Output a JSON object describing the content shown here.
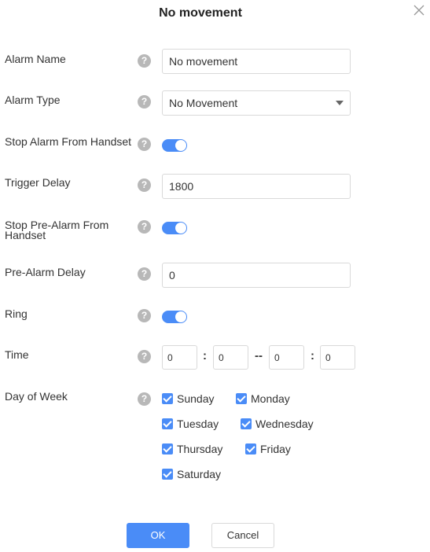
{
  "dialog": {
    "title": "No movement",
    "close_icon": "close-icon"
  },
  "fields": {
    "alarm_name": {
      "label": "Alarm Name",
      "value": "No movement"
    },
    "alarm_type": {
      "label": "Alarm Type",
      "selected": "No Movement"
    },
    "stop_alarm_from_handset": {
      "label": "Stop Alarm From Handset",
      "on": true
    },
    "trigger_delay": {
      "label": "Trigger Delay",
      "value": "1800"
    },
    "stop_pre_alarm_from_handset": {
      "label": "Stop Pre-Alarm From Handset",
      "on": true
    },
    "pre_alarm_delay": {
      "label": "Pre-Alarm Delay",
      "value": "0"
    },
    "ring": {
      "label": "Ring",
      "on": true
    },
    "time": {
      "label": "Time",
      "start_hour": "0",
      "start_minute": "0",
      "end_hour": "0",
      "end_minute": "0",
      "colon": ":",
      "range_separator": "--"
    },
    "day_of_week": {
      "label": "Day of Week",
      "days": [
        {
          "label": "Sunday",
          "checked": true
        },
        {
          "label": "Monday",
          "checked": true
        },
        {
          "label": "Tuesday",
          "checked": true
        },
        {
          "label": "Wednesday",
          "checked": true
        },
        {
          "label": "Thursday",
          "checked": true
        },
        {
          "label": "Friday",
          "checked": true
        },
        {
          "label": "Saturday",
          "checked": true
        }
      ]
    }
  },
  "help_glyph": "?",
  "buttons": {
    "ok": "OK",
    "cancel": "Cancel"
  },
  "colors": {
    "accent": "#4a8cf7",
    "help_icon": "#b8b8b8",
    "border": "#d9d9d9"
  }
}
